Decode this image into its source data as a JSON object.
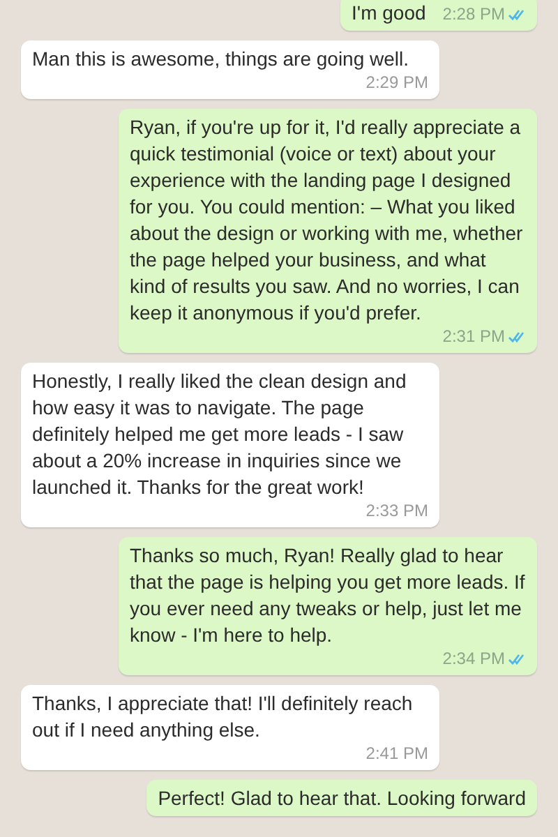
{
  "messages": [
    {
      "kind": "outgoing",
      "text": "I'm good",
      "time": "2:28 PM",
      "read": true
    },
    {
      "kind": "incoming",
      "text": "Man this is awesome, things are going well.",
      "time": "2:29 PM"
    },
    {
      "kind": "outgoing",
      "text": "Ryan, if you're up for it, I'd really appreciate a quick testimonial (voice or text) about your experience with the landing page I designed for you. You could mention: – What you liked about the design or working with me, whether the page helped your business, and what kind of results you saw. And no worries, I can keep it anonymous if you'd prefer.",
      "time": "2:31 PM",
      "read": true
    },
    {
      "kind": "incoming",
      "text": "Honestly, I really liked the clean design and how easy it was to navigate. The page definitely helped me get more leads - I saw about a 20% increase in inquiries since we launched it. Thanks for the great work!",
      "time": "2:33 PM"
    },
    {
      "kind": "outgoing",
      "text": "Thanks so much, Ryan! Really glad to hear that the page is helping you get more leads. If you ever need any tweaks or help, just let me know - I'm here to help.",
      "time": "2:34 PM",
      "read": true
    },
    {
      "kind": "incoming",
      "text": "Thanks, I appreciate that! I'll definitely reach out if I need anything else.",
      "time": "2:41 PM"
    },
    {
      "kind": "outgoing",
      "text": "Perfect! Glad to hear that. Looking forward"
    }
  ]
}
